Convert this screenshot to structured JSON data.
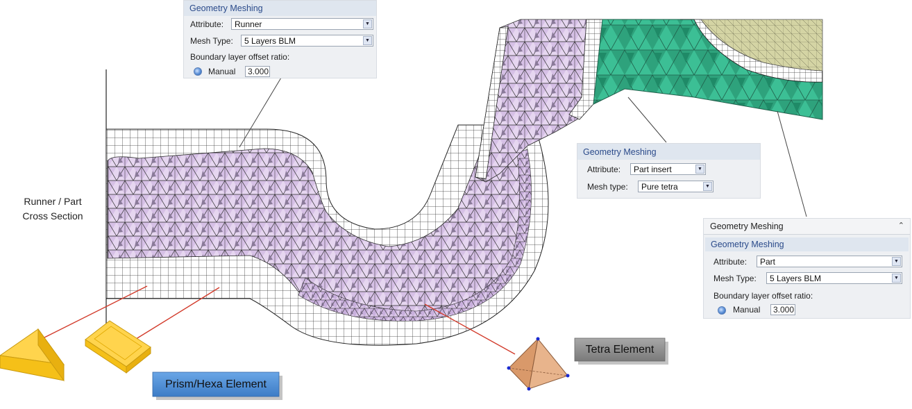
{
  "left_label": {
    "line1": "Runner / Part",
    "line2": "Cross Section"
  },
  "panel_runner": {
    "title": "Geometry Meshing",
    "attribute_label": "Attribute:",
    "attribute_value": "Runner",
    "mesh_type_label": "Mesh Type:",
    "mesh_type_value": "5 Layers BLM",
    "offset_label": "Boundary layer offset ratio:",
    "manual_label": "Manual",
    "manual_value": "3.000"
  },
  "panel_insert": {
    "title": "Geometry Meshing",
    "attribute_label": "Attribute:",
    "attribute_value": "Part insert",
    "mesh_type_label": "Mesh type:",
    "mesh_type_value": "Pure tetra"
  },
  "panel_part": {
    "header": "Geometry Meshing",
    "title": "Geometry Meshing",
    "attribute_label": "Attribute:",
    "attribute_value": "Part",
    "mesh_type_label": "Mesh Type:",
    "mesh_type_value": "5 Layers BLM",
    "offset_label": "Boundary layer offset ratio:",
    "manual_label": "Manual",
    "manual_value": "3.000"
  },
  "labels": {
    "prism_hexa": "Prism/Hexa Element",
    "tetra": "Tetra Element"
  },
  "colors": {
    "mesh_purple": "#e5d5ef",
    "mesh_green": "#3cbf95",
    "insert_olive": "#d6d6a6",
    "element_yellow": "#ffcc33",
    "tetra_orange": "#e0a87c",
    "callout_red": "#d23a2a",
    "prism_button": "#4d8fd6",
    "tetra_button": "#8b8b8b"
  }
}
